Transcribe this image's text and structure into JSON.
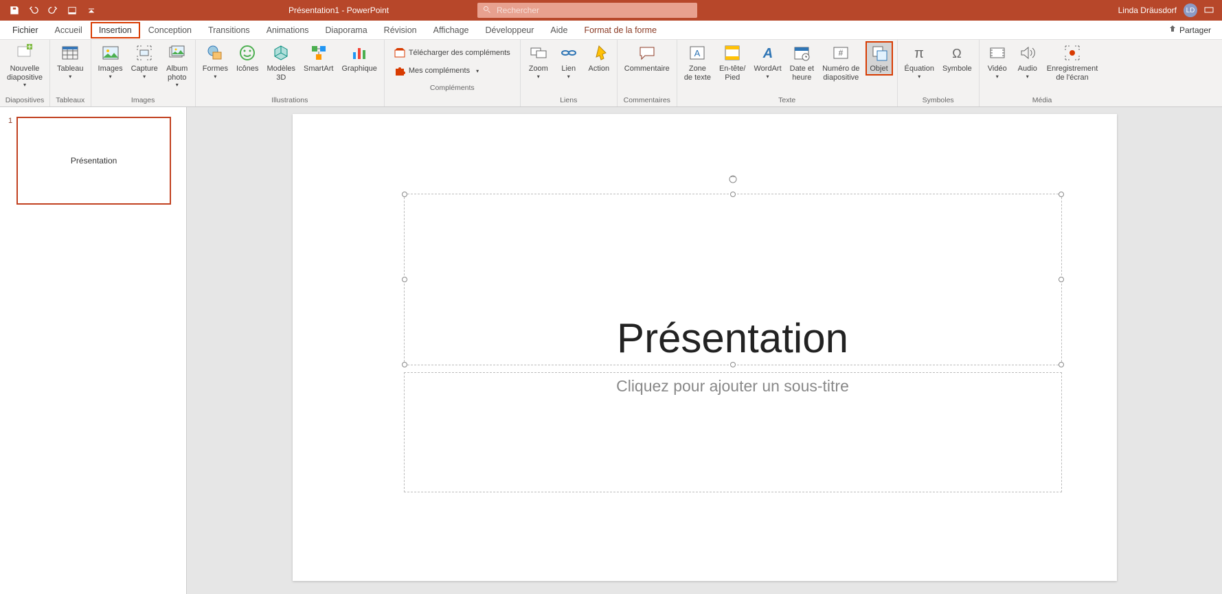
{
  "titlebar": {
    "title": "Présentation1 - PowerPoint",
    "search_placeholder": "Rechercher",
    "username": "Linda Dräusdorf",
    "avatar_initials": "LD"
  },
  "tabs": {
    "file": "Fichier",
    "home": "Accueil",
    "insert": "Insertion",
    "design": "Conception",
    "transitions": "Transitions",
    "animations": "Animations",
    "slideshow": "Diaporama",
    "review": "Révision",
    "view": "Affichage",
    "developer": "Développeur",
    "help": "Aide",
    "shape_format": "Format de la forme",
    "share": "Partager"
  },
  "ribbon_groups": {
    "slides": "Diapositives",
    "tables": "Tableaux",
    "images": "Images",
    "illustrations": "Illustrations",
    "addins": "Compléments",
    "links": "Liens",
    "comments": "Commentaires",
    "text": "Texte",
    "symbols": "Symboles",
    "media": "Média"
  },
  "ribbon_buttons": {
    "new_slide": "Nouvelle\ndiapositive",
    "table": "Tableau",
    "images": "Images",
    "capture": "Capture",
    "album": "Album\nphoto",
    "shapes": "Formes",
    "icons": "Icônes",
    "models3d": "Modèles\n3D",
    "smartart": "SmartArt",
    "chart": "Graphique",
    "get_addins": "Télécharger des compléments",
    "my_addins": "Mes compléments",
    "zoom": "Zoom",
    "link": "Lien",
    "action": "Action",
    "comment": "Commentaire",
    "textbox": "Zone\nde texte",
    "header_footer": "En-tête/\nPied",
    "wordart": "WordArt",
    "date_time": "Date et\nheure",
    "slide_number": "Numéro de\ndiapositive",
    "object": "Objet",
    "equation": "Équation",
    "symbol": "Symbole",
    "video": "Vidéo",
    "audio": "Audio",
    "screen_recording": "Enregistrement\nde l'écran"
  },
  "slide_panel": {
    "slide1_num": "1",
    "slide1_thumb_text": "Présentation"
  },
  "slide_content": {
    "title": "Présentation",
    "subtitle_placeholder": "Cliquez pour ajouter un sous-titre"
  }
}
